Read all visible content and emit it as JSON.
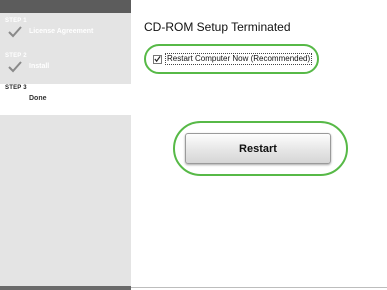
{
  "sidebar": {
    "steps": [
      {
        "number": "STEP 1",
        "label": "License Agreement",
        "status": "completed",
        "icon": "check-icon"
      },
      {
        "number": "STEP 2",
        "label": "Install",
        "status": "completed",
        "icon": "check-icon"
      },
      {
        "number": "STEP 3",
        "label": "Done",
        "status": "current"
      }
    ]
  },
  "main": {
    "title": "CD-ROM Setup Terminated",
    "restart_checkbox": {
      "label": "Restart Computer Now (Recommended)",
      "checked": true
    },
    "restart_button": {
      "label": "Restart"
    }
  },
  "colors": {
    "highlight_ring": "#57b947",
    "sidebar_bg": "#e4e4e4",
    "sidebar_bar": "#5c5c5c"
  }
}
